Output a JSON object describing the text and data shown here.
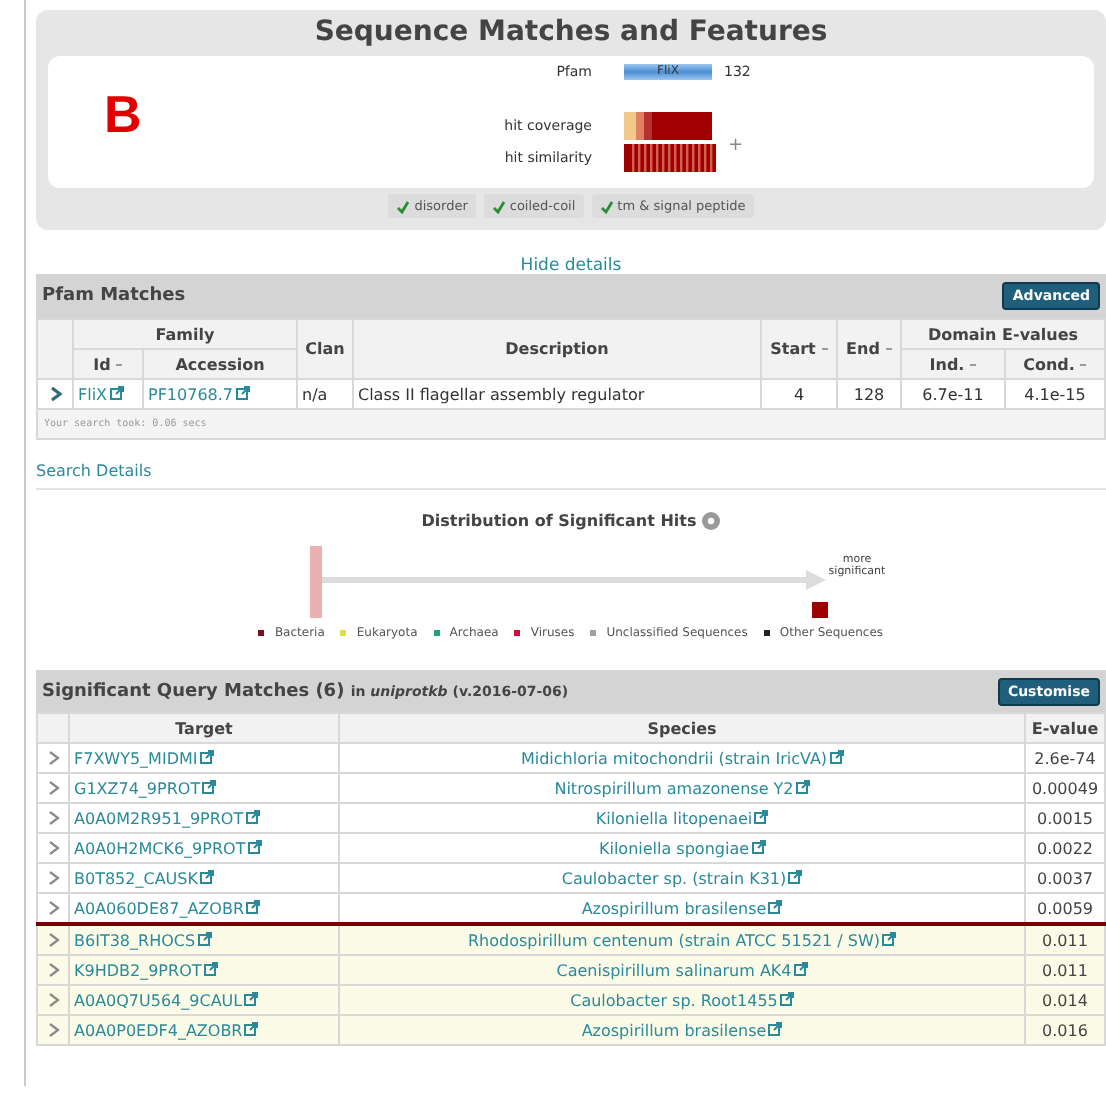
{
  "features": {
    "title": "Sequence Matches and Features",
    "panel_label": "B",
    "pfam": {
      "label": "Pfam",
      "domain": "FliX",
      "length": "132"
    },
    "coverage_label": "hit coverage",
    "similarity_label": "hit similarity",
    "expand": "+",
    "toggles": [
      {
        "label": "disorder",
        "checked": true
      },
      {
        "label": "coiled-coil",
        "checked": true
      },
      {
        "label": "tm & signal peptide",
        "checked": true
      }
    ],
    "hide_link": "Hide details"
  },
  "pfam_matches": {
    "title": "Pfam Matches",
    "button": "Advanced",
    "group_headers": [
      "Family",
      "Domain E-values"
    ],
    "columns": [
      "Id",
      "Accession",
      "Clan",
      "Description",
      "Start",
      "End",
      "Ind.",
      "Cond."
    ],
    "rows": [
      {
        "id": "FliX",
        "accession": "PF10768.7",
        "clan": "n/a",
        "description": "Class II flagellar assembly regulator",
        "start": "4",
        "end": "128",
        "ind": "6.7e-11",
        "cond": "4.1e-15"
      }
    ],
    "footer": "Your search took: 0.06 secs"
  },
  "search_details": "Search Details",
  "distribution": {
    "title": "Distribution of Significant Hits",
    "arrow_label": "more significant",
    "legend": [
      {
        "label": "Bacteria",
        "color": "#7a1020"
      },
      {
        "label": "Eukaryota",
        "color": "#e0e040"
      },
      {
        "label": "Archaea",
        "color": "#20a080"
      },
      {
        "label": "Viruses",
        "color": "#d0103a"
      },
      {
        "label": "Unclassified Sequences",
        "color": "#a0a0a0"
      },
      {
        "label": "Other Sequences",
        "color": "#222222"
      }
    ]
  },
  "query_matches": {
    "title": "Significant Query Matches (6)",
    "db_prefix": "in",
    "db": "uniprotkb",
    "version": "(v.2016-07-06)",
    "button": "Customise",
    "columns": [
      "Target",
      "Species",
      "E-value"
    ],
    "rows": [
      {
        "target": "F7XWY5_MIDMI",
        "species": "Midichloria mitochondrii (strain IricVA)",
        "evalue": "2.6e-74",
        "significant": true
      },
      {
        "target": "G1XZ74_9PROT",
        "species": "Nitrospirillum amazonense Y2",
        "evalue": "0.00049",
        "significant": true
      },
      {
        "target": "A0A0M2R951_9PROT",
        "species": "Kiloniella litopenaei",
        "evalue": "0.0015",
        "significant": true
      },
      {
        "target": "A0A0H2MCK6_9PROT",
        "species": "Kiloniella spongiae",
        "evalue": "0.0022",
        "significant": true
      },
      {
        "target": "B0T852_CAUSK",
        "species": "Caulobacter sp. (strain K31)",
        "evalue": "0.0037",
        "significant": true
      },
      {
        "target": "A0A060DE87_AZOBR",
        "species": "Azospirillum brasilense",
        "evalue": "0.0059",
        "significant": true
      },
      {
        "target": "B6IT38_RHOCS",
        "species": "Rhodospirillum centenum (strain ATCC 51521 / SW)",
        "evalue": "0.011",
        "significant": false
      },
      {
        "target": "K9HDB2_9PROT",
        "species": "Caenispirillum salinarum AK4",
        "evalue": "0.011",
        "significant": false
      },
      {
        "target": "A0A0Q7U564_9CAUL",
        "species": "Caulobacter sp. Root1455",
        "evalue": "0.014",
        "significant": false
      },
      {
        "target": "A0A0P0EDF4_AZOBR",
        "species": "Azospirillum brasilense",
        "evalue": "0.016",
        "significant": false
      }
    ]
  }
}
